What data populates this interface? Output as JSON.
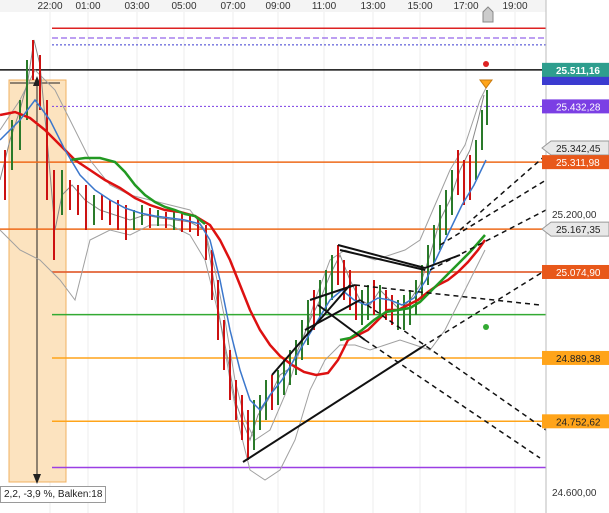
{
  "chart_data": {
    "type": "line",
    "time_labels": [
      "22:00",
      "01:00",
      "03:00",
      "05:00",
      "07:00",
      "09:00",
      "11:00",
      "13:00",
      "15:00",
      "17:00",
      "19:00"
    ],
    "price_axis_labels": [
      "25.200,00",
      "24.600,00"
    ],
    "ylim": [
      24572,
      25636
    ],
    "grid": false,
    "price_tags": [
      {
        "value": "25.511,16",
        "y": 25511.16,
        "bg": "#2e9e8e",
        "fg": "#ffffff",
        "bold": true
      },
      {
        "value": "25.432,28",
        "y": 25432.28,
        "bg": "#7b3fe4",
        "fg": "#ffffff"
      },
      {
        "value": "25.342,45",
        "y": 25342.45,
        "bg": "#e8e8e8",
        "fg": "#222222",
        "pointer": true
      },
      {
        "value": "25.311,98",
        "y": 25311.98,
        "bg": "#e8581a",
        "fg": "#ffffff"
      },
      {
        "value": "25.167,35",
        "y": 25167.35,
        "bg": "#e8e8e8",
        "fg": "#222222",
        "pointer": true
      },
      {
        "value": "25.074,90",
        "y": 25074.9,
        "bg": "#e8581a",
        "fg": "#ffffff"
      },
      {
        "value": "24.889,38",
        "y": 24889.38,
        "bg": "#ffa41a",
        "fg": "#222222"
      },
      {
        "value": "24.752,62",
        "y": 24752.62,
        "bg": "#ffa41a",
        "fg": "#222222"
      }
    ],
    "measure_label": "2,2, -3,9 %, Balken:18",
    "colors": {
      "price_up": "#2a7a2a",
      "price_down": "#cc1111",
      "ma_red": "#dd1111",
      "ma_green": "#229922",
      "ma_blue": "#3b77cc",
      "bollinger": "#a0a0a0",
      "red_line": "#dd2222",
      "orange_line": "#ee6a1a",
      "purple_line": "#9b3fe4",
      "amber_line": "#ffa41a",
      "green_line": "#33aa33",
      "measure_fill": "#fce3bf",
      "trend_line": "#111111"
    },
    "horizontal_levels": [
      {
        "y": 25601,
        "color": "#dd2222",
        "style": "solid",
        "x0": 52
      },
      {
        "y": 25580,
        "color": "#7b3fe4",
        "style": "dashed",
        "x0": 52
      },
      {
        "y": 25565,
        "color": "#3b3bd0",
        "style": "dotted",
        "x0": 52
      },
      {
        "y": 25511.16,
        "color": "#111111",
        "style": "solid",
        "x0": 0
      },
      {
        "y": 25432.28,
        "color": "#7b3fe4",
        "style": "dotted",
        "x0": 52
      },
      {
        "y": 25311.98,
        "color": "#ee6a1a",
        "style": "solid",
        "x0": 0
      },
      {
        "y": 25167.35,
        "color": "#ee6a1a",
        "style": "solid",
        "x0": 0
      },
      {
        "y": 25074.9,
        "color": "#9b3fe4",
        "style": "solid",
        "x0": 52
      },
      {
        "y": 25074.9,
        "color": "#ee6a1a",
        "style": "solid",
        "x0": 52
      },
      {
        "y": 24983,
        "color": "#33aa33",
        "style": "solid",
        "x0": 52
      },
      {
        "y": 24889.38,
        "color": "#ffa41a",
        "style": "solid",
        "x0": 52
      },
      {
        "y": 24752.62,
        "color": "#ffa41a",
        "style": "solid",
        "x0": 52
      },
      {
        "y": 24653,
        "color": "#9b3fe4",
        "style": "solid",
        "x0": 52
      }
    ]
  },
  "icons": {
    "scroll_home": "home-icon",
    "alert_marker": "alert-triangle-icon"
  }
}
